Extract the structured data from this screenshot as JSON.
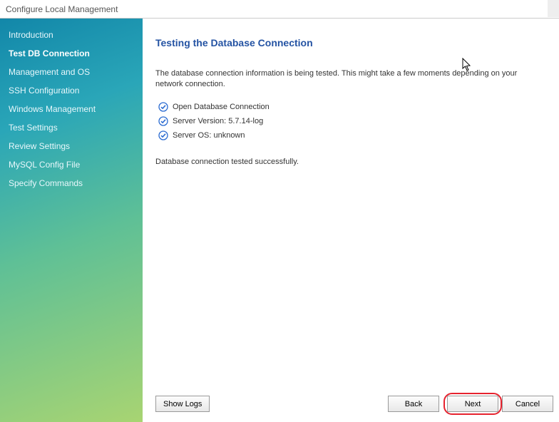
{
  "window": {
    "title": "Configure Local Management"
  },
  "sidebar": {
    "items": [
      {
        "label": "Introduction"
      },
      {
        "label": "Test DB Connection"
      },
      {
        "label": "Management and OS"
      },
      {
        "label": "SSH Configuration"
      },
      {
        "label": "Windows Management"
      },
      {
        "label": "Test Settings"
      },
      {
        "label": "Review Settings"
      },
      {
        "label": "MySQL Config File"
      },
      {
        "label": "Specify Commands"
      }
    ],
    "activeIndex": 1
  },
  "main": {
    "heading": "Testing the Database Connection",
    "description": "The database connection information is being tested. This might take a few moments depending on your network connection.",
    "checks": [
      {
        "label": "Open Database Connection"
      },
      {
        "label": "Server Version: 5.7.14-log"
      },
      {
        "label": "Server OS: unknown"
      }
    ],
    "status": "Database connection tested successfully."
  },
  "buttons": {
    "showLogs": "Show Logs",
    "back": "Back",
    "next": "Next",
    "cancel": "Cancel"
  }
}
